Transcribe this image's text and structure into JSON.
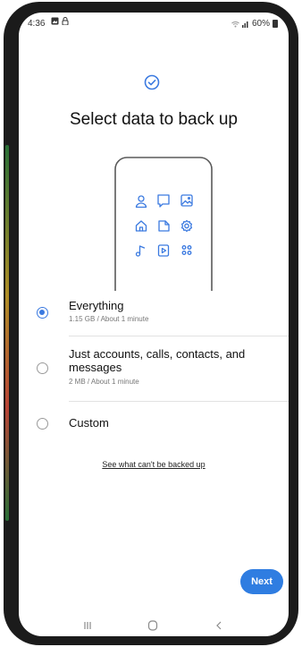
{
  "status_bar": {
    "time": "4:36",
    "battery": "60%"
  },
  "header": {
    "title": "Select data to back up"
  },
  "illustration_icons": [
    "person-icon",
    "chat-icon",
    "image-icon",
    "home-icon",
    "document-icon",
    "settings-icon",
    "music-icon",
    "video-icon",
    "apps-icon"
  ],
  "options": [
    {
      "label": "Everything",
      "sub": "1.15 GB / About 1 minute",
      "selected": true
    },
    {
      "label_line1": "Just accounts, calls, contacts, and",
      "label_line2": "messages",
      "sub": "2 MB / About 1 minute",
      "selected": false
    },
    {
      "label": "Custom",
      "selected": false
    }
  ],
  "link": {
    "text": "See what can't be backed up"
  },
  "footer": {
    "next_label": "Next"
  },
  "colors": {
    "accent": "#2f7de1",
    "icon_blue": "#3b7ae0"
  }
}
